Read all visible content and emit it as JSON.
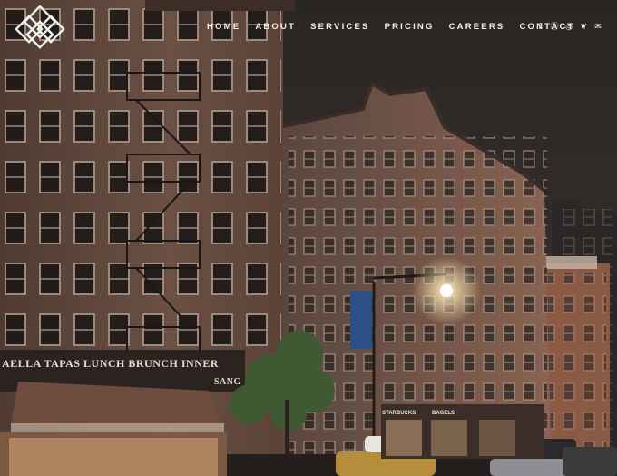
{
  "logo": {
    "icon": "interlaced-knot-logo-icon"
  },
  "nav": {
    "items": [
      "HOME",
      "ABOUT",
      "SERVICES",
      "PRICING",
      "CAREERS",
      "CONTACT"
    ]
  },
  "social": {
    "icons": [
      "facebook-icon",
      "pinterest-icon",
      "instagram-icon",
      "twitter-icon",
      "email-icon"
    ],
    "glyphs": [
      "f",
      "Ⓟ",
      "◎",
      "❦",
      "✉"
    ]
  },
  "scene": {
    "restaurant_sign": "AELLA  TAPAS  LUNCH  BRUNCH  INNER",
    "side_sign": "SANG",
    "shop_sign_1": "STARBUCKS",
    "shop_sign_2": "BAGELS"
  },
  "colors": {
    "nav_text": "#f3f1ee",
    "sky": "#2a2624",
    "brick_left": "#6b5043",
    "brick_right": "#8a6452",
    "awning": "#6e4c3e"
  }
}
